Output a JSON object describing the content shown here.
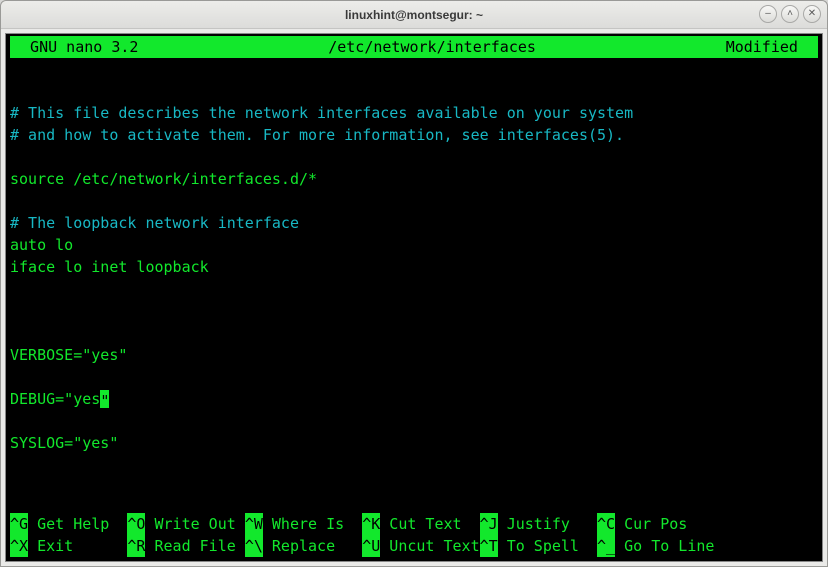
{
  "window": {
    "title": "linuxhint@montsegur: ~",
    "buttons": {
      "min": "–",
      "max": "˄",
      "close": "✕"
    }
  },
  "nano": {
    "app": "  GNU nano 3.2",
    "file": "/etc/network/interfaces",
    "status": "Modified  "
  },
  "lines": {
    "l1": "# This file describes the network interfaces available on your system",
    "l2": "# and how to activate them. For more information, see interfaces(5).",
    "l3": "",
    "l4": "source /etc/network/interfaces.d/*",
    "l5": "",
    "l6": "# The loopback network interface",
    "l7": "auto lo",
    "l8": "iface lo inet loopback",
    "l9": "",
    "l10": "",
    "l11": "",
    "l12": "VERBOSE=\"yes\"",
    "l13": "",
    "l14a": "DEBUG=\"yes",
    "l14b": "\"",
    "l15": "",
    "l16": "SYSLOG=\"yes\""
  },
  "shortcuts": {
    "r1": {
      "k1": "^G",
      "t1": " Get Help  ",
      "k2": "^O",
      "t2": " Write Out ",
      "k3": "^W",
      "t3": " Where Is  ",
      "k4": "^K",
      "t4": " Cut Text  ",
      "k5": "^J",
      "t5": " Justify   ",
      "k6": "^C",
      "t6": " Cur Pos"
    },
    "r2": {
      "k1": "^X",
      "t1": " Exit      ",
      "k2": "^R",
      "t2": " Read File ",
      "k3": "^\\",
      "t3": " Replace   ",
      "k4": "^U",
      "t4": " Uncut Text",
      "k5": "^T",
      "t5": " To Spell  ",
      "k6": "^_",
      "t6": " Go To Line"
    }
  }
}
